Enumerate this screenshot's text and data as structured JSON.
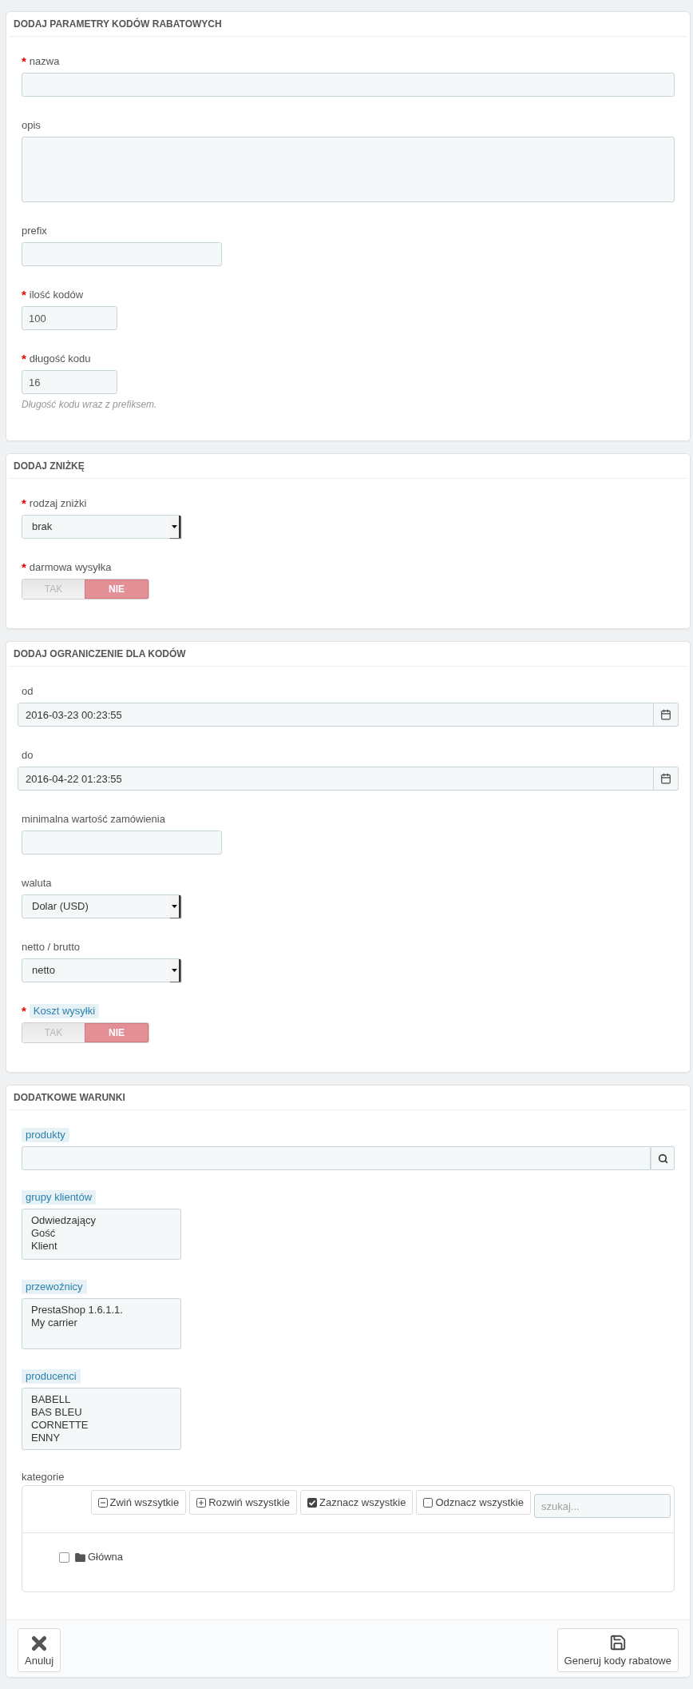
{
  "sections": [
    {
      "title": "DODAJ PARAMETRY KODÓW RABATOWYCH",
      "fields": [
        {
          "kind": "text-wide",
          "marker": "*",
          "label": "nazwa",
          "hinted": false
        },
        {
          "kind": "textarea",
          "label": "opis",
          "hinted": false
        },
        {
          "kind": "text",
          "label": "prefix",
          "hinted": false
        },
        {
          "kind": "number",
          "marker": "*",
          "label": "ilość kodów",
          "hinted": false,
          "value": "100"
        },
        {
          "kind": "number",
          "marker": "*",
          "label": "długość kodu",
          "hinted": false,
          "value": "16",
          "help": "Długość kodu wraz z prefiksem."
        }
      ]
    },
    {
      "title": "DODAJ ZNIŻKĘ",
      "fields": [
        {
          "kind": "select",
          "marker": "*",
          "label": "rodzaj zniżki",
          "hinted": false,
          "value": "brak"
        },
        {
          "kind": "switch",
          "marker": "*",
          "label": "darmowa wysyłka",
          "hinted": false,
          "options": [
            {
              "label": "TAK",
              "selected": false
            },
            {
              "label": "NIE",
              "selected": true
            }
          ]
        }
      ]
    },
    {
      "title": "DODAJ OGRANICZENIE DLA KODÓW",
      "fields": [
        {
          "kind": "date",
          "label": "od",
          "hinted": false,
          "value": "2016-03-23 00:23:55"
        },
        {
          "kind": "date",
          "label": "do",
          "hinted": false,
          "value": "2016-04-22 01:23:55"
        },
        {
          "kind": "text",
          "label": "minimalna wartość zamówienia",
          "hinted": false
        },
        {
          "kind": "select",
          "label": "waluta",
          "hinted": false,
          "value": "Dolar (USD)"
        },
        {
          "kind": "select",
          "label": "netto / brutto",
          "hinted": false,
          "value": "netto"
        },
        {
          "kind": "switch",
          "marker": "*",
          "label": "Koszt wysyłki",
          "hinted": true,
          "options": [
            {
              "label": "TAK",
              "selected": false
            },
            {
              "label": "NIE",
              "selected": true
            }
          ]
        }
      ]
    },
    {
      "title": "DODATKOWE WARUNKI",
      "fields": [
        {
          "kind": "search",
          "label": "produkty",
          "hinted": true
        },
        {
          "kind": "listbox",
          "label": "grupy klientów",
          "hinted": true,
          "items": [
            "Odwiedzający",
            "Gość",
            "Klient"
          ]
        },
        {
          "kind": "listbox",
          "label": "przewoźnicy",
          "hinted": true,
          "items": [
            "PrestaShop 1.6.1.1.",
            "My carrier"
          ]
        },
        {
          "kind": "listbox",
          "label": "producenci",
          "hinted": true,
          "items": [
            "BABELL",
            "BAS BLEU",
            "CORNETTE",
            "ENNY"
          ]
        },
        {
          "kind": "tree",
          "label": "kategorie",
          "hinted": false,
          "buttons": [
            {
              "kind": "collapse",
              "label": "Zwiń wszsytkie"
            },
            {
              "kind": "expand",
              "label": "Rozwiń wszystkie"
            },
            {
              "kind": "check-all",
              "label": "Zaznacz wszystkie"
            },
            {
              "kind": "uncheck-all",
              "label": "Odznacz wszystkie"
            }
          ],
          "search": {
            "placeholder": "szukaj..."
          },
          "items": [
            {
              "label": "Główna",
              "checked": false
            }
          ]
        }
      ],
      "footer": {
        "buttons": [
          {
            "kind": "cancel",
            "label": "Anuluj"
          },
          {
            "kind": "save",
            "label": "Generuj kody rabatowe"
          }
        ]
      }
    }
  ]
}
